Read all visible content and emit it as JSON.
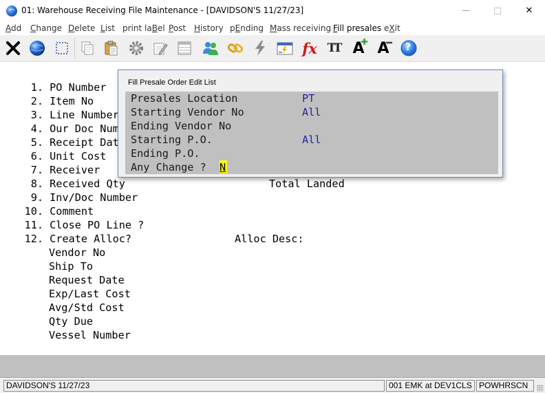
{
  "window": {
    "title": "01: Warehouse Receiving File Maintenance - [DAVIDSON'S 11/27/23]",
    "close_glyph": "✕"
  },
  "menu": [
    {
      "pre": "",
      "key": "A",
      "post": "dd"
    },
    {
      "pre": "",
      "key": "C",
      "post": "hange"
    },
    {
      "pre": "",
      "key": "D",
      "post": "elete"
    },
    {
      "pre": "",
      "key": "L",
      "post": "ist"
    },
    {
      "pre": "print la",
      "key": "B",
      "post": "el"
    },
    {
      "pre": "",
      "key": "P",
      "post": "ost"
    },
    {
      "pre": "",
      "key": "H",
      "post": "istory"
    },
    {
      "pre": "p",
      "key": "E",
      "post": "nding"
    },
    {
      "pre": "",
      "key": "M",
      "post": "ass receiving"
    },
    {
      "pre": "",
      "key": "F",
      "post": "ill presales"
    },
    {
      "pre": "e",
      "key": "X",
      "post": "it"
    }
  ],
  "toolbar": {
    "icons": [
      "close-icon",
      "globe-icon",
      "select-icon",
      "copy-icon",
      "paste-icon",
      "settings-icon",
      "edit-icon",
      "list-icon",
      "users-icon",
      "link-icon",
      "lightning-icon",
      "calculator-icon",
      "function-icon",
      "font-icon",
      "font-increase-icon",
      "font-decrease-icon",
      "help-icon"
    ],
    "fx_label": "fx",
    "font_label": "TT",
    "font_inc_label": "A",
    "font_dec_label": "A",
    "help_label": "?"
  },
  "form": {
    "fields": [
      {
        "num": "1.",
        "label": "PO Number"
      },
      {
        "num": "2.",
        "label": "Item No"
      },
      {
        "num": "3.",
        "label": "Line Number"
      },
      {
        "num": "4.",
        "label": "Our Doc Number"
      },
      {
        "num": "5.",
        "label": "Receipt Date"
      },
      {
        "num": "6.",
        "label": "Unit Cost"
      },
      {
        "num": "7.",
        "label": "Receiver"
      },
      {
        "num": "8.",
        "label": "Received Qty"
      },
      {
        "num": "9.",
        "label": "Inv/Doc Number"
      },
      {
        "num": "10.",
        "label": "Comment"
      },
      {
        "num": "11.",
        "label": "Close PO Line ?"
      },
      {
        "num": "12.",
        "label": "Create Alloc?"
      }
    ],
    "sub_fields": [
      "Vendor No",
      "Ship To",
      "Request Date",
      "Exp/Last Cost",
      "Avg/Std Cost",
      "Qty Due",
      "Vessel Number"
    ],
    "total_landed_label": "Total Landed",
    "alloc_desc_label": "Alloc Desc:"
  },
  "dialog": {
    "title": "Fill Presale Order Edit List",
    "rows": [
      {
        "label": "Presales Location",
        "value": "PT"
      },
      {
        "label": "Starting Vendor No",
        "value": "All"
      },
      {
        "label": "Ending Vendor No",
        "value": ""
      },
      {
        "label": "Starting P.O.",
        "value": "All"
      },
      {
        "label": "Ending P.O.",
        "value": ""
      }
    ],
    "prompt_label": "Any Change ?",
    "prompt_value": "N"
  },
  "status": {
    "company": "DAVIDSON'S 11/27/23",
    "session": "001 EMK at DEV1CLS",
    "program": "POWHRSCN"
  }
}
